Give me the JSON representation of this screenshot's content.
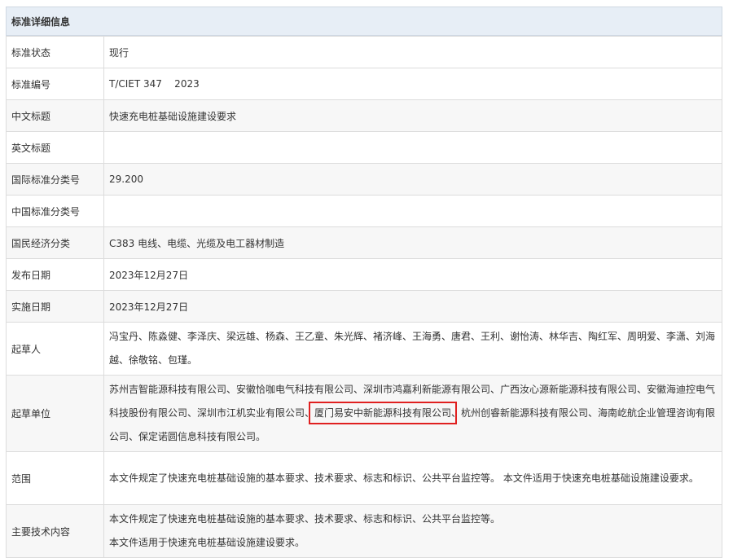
{
  "header": {
    "title": "标准详细信息"
  },
  "rows": [
    {
      "label": "标准状态",
      "value": "现行"
    },
    {
      "label": "标准编号",
      "value": "T/CIET 347    2023"
    },
    {
      "label": "中文标题",
      "value": "快速充电桩基础设施建设要求"
    },
    {
      "label": "英文标题",
      "value": ""
    },
    {
      "label": "国际标准分类号",
      "value": "29.200"
    },
    {
      "label": "中国标准分类号",
      "value": ""
    },
    {
      "label": "国民经济分类",
      "value": "C383 电线、电缆、光缆及电工器材制造"
    },
    {
      "label": "发布日期",
      "value": "2023年12月27日"
    },
    {
      "label": "实施日期",
      "value": "2023年12月27日"
    },
    {
      "label": "起草人",
      "value": "冯宝丹、陈淼健、李泽庆、梁远雄、杨森、王乙童、朱光辉、褚济峰、王海勇、唐君、王利、谢怡涛、林华吉、陶红军、周明爱、李潇、刘海越、徐敬铭、包瑾。"
    },
    {
      "label": "起草单位",
      "value_before": "苏州吉智能源科技有限公司、安徽恰咖电气科技有限公司、深圳市鸿嘉利新能源有限公司、广西汝心源新能源科技有限公司、安徽海迪控电气科技股份有限公司、深圳市江机实业有限公司、",
      "value_highlight": "厦门易安中新能源科技有限公司",
      "value_after": "、杭州创睿新能源科技有限公司、海南屹航企业管理咨询有限公司、保定诺圆信息科技有限公司。"
    },
    {
      "label": "范围",
      "value": "本文件规定了快速充电桩基础设施的基本要求、技术要求、标志和标识、公共平台监控等。 本文件适用于快速充电桩基础设施建设要求。"
    },
    {
      "label": "主要技术内容",
      "value_line1": "本文件规定了快速充电桩基础设施的基本要求、技术要求、标志和标识、公共平台监控等。",
      "value_line2": "本文件适用于快速充电桩基础设施建设要求。"
    }
  ],
  "colors": {
    "highlight_border": "#e02020",
    "header_bg": "#e7eef6",
    "alt_row_bg": "#f7f7f7"
  }
}
